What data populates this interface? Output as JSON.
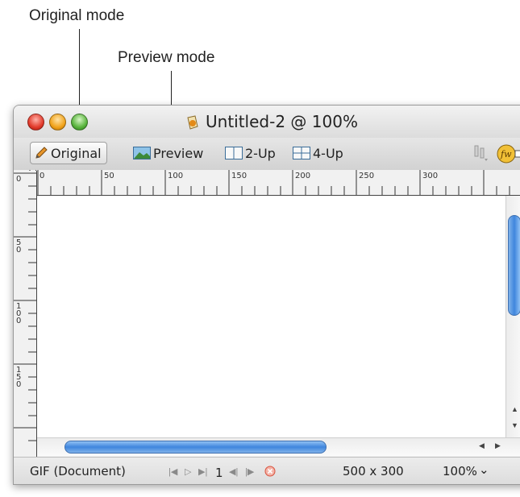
{
  "annotations": {
    "original_mode": "Original mode",
    "preview_mode": "Preview mode"
  },
  "window": {
    "title": "Untitled-2 @ 100%",
    "traffic_lights": [
      "close",
      "minimize",
      "zoom"
    ]
  },
  "toolbar": {
    "tabs": [
      {
        "label": "Original",
        "icon": "pencil-icon",
        "active": true
      },
      {
        "label": "Preview",
        "icon": "image-icon",
        "active": false
      },
      {
        "label": "2-Up",
        "icon": "two-up-icon",
        "active": false
      },
      {
        "label": "4-Up",
        "icon": "four-up-icon",
        "active": false
      }
    ],
    "right_icons": [
      "pointer-tools-icon",
      "fireworks-edit-icon"
    ]
  },
  "rulers": {
    "horizontal": [
      "0",
      "50",
      "100",
      "150",
      "200",
      "250",
      "300"
    ],
    "vertical": [
      "0",
      "50",
      "100",
      "150"
    ]
  },
  "statusbar": {
    "format": "GIF (Document)",
    "frame_number": "1",
    "dimensions": "500 x 300",
    "zoom": "100%",
    "zoom_arrow": "⌄"
  },
  "colors": {
    "accent_blue": "#3f86dd",
    "close_red": "#e23b2c",
    "minimize_yellow": "#f1a31b",
    "zoom_green": "#59b43d"
  }
}
